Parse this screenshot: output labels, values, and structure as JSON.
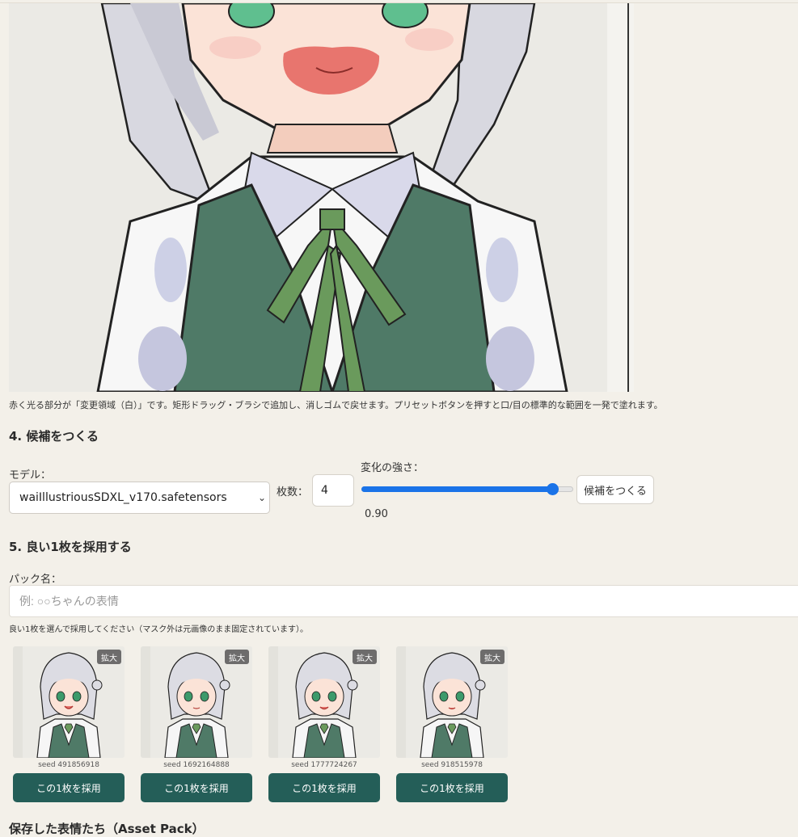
{
  "editor": {
    "hint": "赤く光る部分が「変更領域（白）」です。矩形ドラッグ・ブラシで追加し、消しゴムで戻せます。プリセットボタンを押すと口/目の標準的な範囲を一発で塗れます。"
  },
  "generate": {
    "title": "4. 候補をつくる",
    "model_label": "モデル：",
    "model_value": "waiIllustriousSDXL_v170.safetensors",
    "count_label": "枚数：",
    "count_value": "4",
    "strength_label": "変化の強さ：",
    "strength_value": 0.9,
    "strength_text": "0.90",
    "button_label": "候補をつくる"
  },
  "adopt": {
    "title": "5. 良い1枚を採用する",
    "pack_label": "パック名：",
    "pack_placeholder": "例: ○○ちゃんの表情",
    "note": "良い1枚を選んで採用してください（マスク外は元画像のまま固定されています）。",
    "candidates": [
      {
        "zoom": "拡大",
        "seed": "seed  491856918",
        "button": "この1枚を採用"
      },
      {
        "zoom": "拡大",
        "seed": "seed  1692164888",
        "button": "この1枚を採用"
      },
      {
        "zoom": "拡大",
        "seed": "seed  1777724267",
        "button": "この1枚を採用"
      },
      {
        "zoom": "拡大",
        "seed": "seed  918515978",
        "button": "この1枚を採用"
      }
    ]
  },
  "next_section": {
    "title": "保存した表情たち（Asset Pack）"
  },
  "colors": {
    "background": "#f3f0e9",
    "accent": "#1a73e8",
    "adopt_button": "#245e58",
    "vest": "#4f7a67",
    "ribbon": "#6a9a5c"
  }
}
